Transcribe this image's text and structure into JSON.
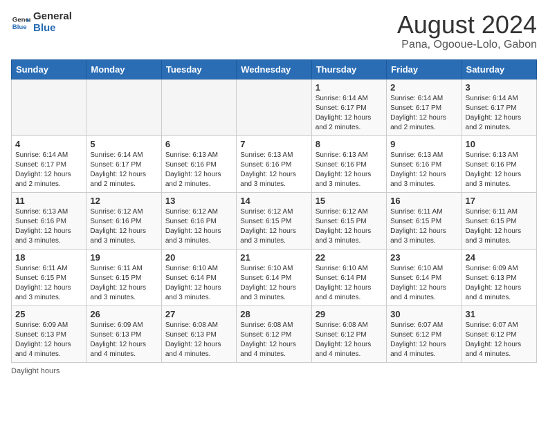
{
  "header": {
    "logo_general": "General",
    "logo_blue": "Blue",
    "title": "August 2024",
    "subtitle": "Pana, Ogooue-Lolo, Gabon"
  },
  "days_of_week": [
    "Sunday",
    "Monday",
    "Tuesday",
    "Wednesday",
    "Thursday",
    "Friday",
    "Saturday"
  ],
  "weeks": [
    [
      {
        "day": "",
        "info": ""
      },
      {
        "day": "",
        "info": ""
      },
      {
        "day": "",
        "info": ""
      },
      {
        "day": "",
        "info": ""
      },
      {
        "day": "1",
        "info": "Sunrise: 6:14 AM\nSunset: 6:17 PM\nDaylight: 12 hours and 2 minutes."
      },
      {
        "day": "2",
        "info": "Sunrise: 6:14 AM\nSunset: 6:17 PM\nDaylight: 12 hours and 2 minutes."
      },
      {
        "day": "3",
        "info": "Sunrise: 6:14 AM\nSunset: 6:17 PM\nDaylight: 12 hours and 2 minutes."
      }
    ],
    [
      {
        "day": "4",
        "info": "Sunrise: 6:14 AM\nSunset: 6:17 PM\nDaylight: 12 hours and 2 minutes."
      },
      {
        "day": "5",
        "info": "Sunrise: 6:14 AM\nSunset: 6:17 PM\nDaylight: 12 hours and 2 minutes."
      },
      {
        "day": "6",
        "info": "Sunrise: 6:13 AM\nSunset: 6:16 PM\nDaylight: 12 hours and 2 minutes."
      },
      {
        "day": "7",
        "info": "Sunrise: 6:13 AM\nSunset: 6:16 PM\nDaylight: 12 hours and 3 minutes."
      },
      {
        "day": "8",
        "info": "Sunrise: 6:13 AM\nSunset: 6:16 PM\nDaylight: 12 hours and 3 minutes."
      },
      {
        "day": "9",
        "info": "Sunrise: 6:13 AM\nSunset: 6:16 PM\nDaylight: 12 hours and 3 minutes."
      },
      {
        "day": "10",
        "info": "Sunrise: 6:13 AM\nSunset: 6:16 PM\nDaylight: 12 hours and 3 minutes."
      }
    ],
    [
      {
        "day": "11",
        "info": "Sunrise: 6:13 AM\nSunset: 6:16 PM\nDaylight: 12 hours and 3 minutes."
      },
      {
        "day": "12",
        "info": "Sunrise: 6:12 AM\nSunset: 6:16 PM\nDaylight: 12 hours and 3 minutes."
      },
      {
        "day": "13",
        "info": "Sunrise: 6:12 AM\nSunset: 6:16 PM\nDaylight: 12 hours and 3 minutes."
      },
      {
        "day": "14",
        "info": "Sunrise: 6:12 AM\nSunset: 6:15 PM\nDaylight: 12 hours and 3 minutes."
      },
      {
        "day": "15",
        "info": "Sunrise: 6:12 AM\nSunset: 6:15 PM\nDaylight: 12 hours and 3 minutes."
      },
      {
        "day": "16",
        "info": "Sunrise: 6:11 AM\nSunset: 6:15 PM\nDaylight: 12 hours and 3 minutes."
      },
      {
        "day": "17",
        "info": "Sunrise: 6:11 AM\nSunset: 6:15 PM\nDaylight: 12 hours and 3 minutes."
      }
    ],
    [
      {
        "day": "18",
        "info": "Sunrise: 6:11 AM\nSunset: 6:15 PM\nDaylight: 12 hours and 3 minutes."
      },
      {
        "day": "19",
        "info": "Sunrise: 6:11 AM\nSunset: 6:15 PM\nDaylight: 12 hours and 3 minutes."
      },
      {
        "day": "20",
        "info": "Sunrise: 6:10 AM\nSunset: 6:14 PM\nDaylight: 12 hours and 3 minutes."
      },
      {
        "day": "21",
        "info": "Sunrise: 6:10 AM\nSunset: 6:14 PM\nDaylight: 12 hours and 3 minutes."
      },
      {
        "day": "22",
        "info": "Sunrise: 6:10 AM\nSunset: 6:14 PM\nDaylight: 12 hours and 4 minutes."
      },
      {
        "day": "23",
        "info": "Sunrise: 6:10 AM\nSunset: 6:14 PM\nDaylight: 12 hours and 4 minutes."
      },
      {
        "day": "24",
        "info": "Sunrise: 6:09 AM\nSunset: 6:13 PM\nDaylight: 12 hours and 4 minutes."
      }
    ],
    [
      {
        "day": "25",
        "info": "Sunrise: 6:09 AM\nSunset: 6:13 PM\nDaylight: 12 hours and 4 minutes."
      },
      {
        "day": "26",
        "info": "Sunrise: 6:09 AM\nSunset: 6:13 PM\nDaylight: 12 hours and 4 minutes."
      },
      {
        "day": "27",
        "info": "Sunrise: 6:08 AM\nSunset: 6:13 PM\nDaylight: 12 hours and 4 minutes."
      },
      {
        "day": "28",
        "info": "Sunrise: 6:08 AM\nSunset: 6:12 PM\nDaylight: 12 hours and 4 minutes."
      },
      {
        "day": "29",
        "info": "Sunrise: 6:08 AM\nSunset: 6:12 PM\nDaylight: 12 hours and 4 minutes."
      },
      {
        "day": "30",
        "info": "Sunrise: 6:07 AM\nSunset: 6:12 PM\nDaylight: 12 hours and 4 minutes."
      },
      {
        "day": "31",
        "info": "Sunrise: 6:07 AM\nSunset: 6:12 PM\nDaylight: 12 hours and 4 minutes."
      }
    ]
  ],
  "footer": {
    "daylight_label": "Daylight hours"
  }
}
